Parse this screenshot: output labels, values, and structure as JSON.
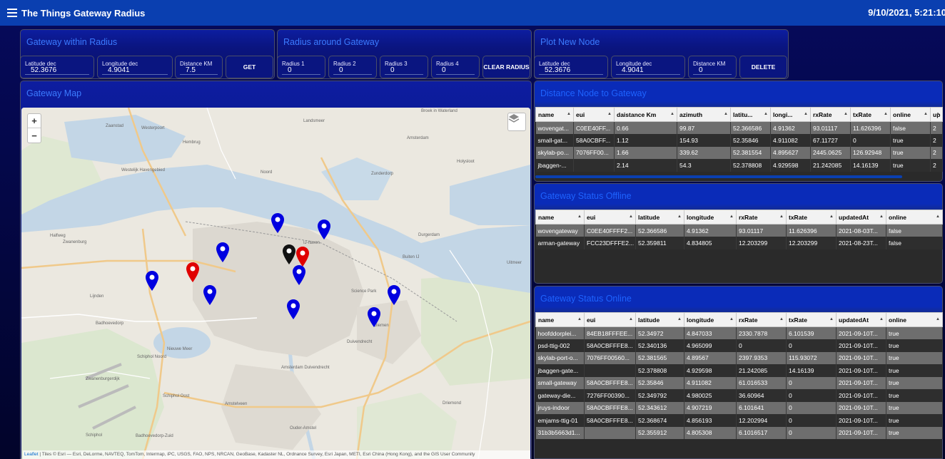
{
  "header": {
    "title": "The Things Gateway Radius",
    "datetime": "9/10/2021, 5:21:10"
  },
  "gateway_within_radius": {
    "title": "Gateway within Radius",
    "latitude": {
      "label": "Latitude dec",
      "value": "52.3676"
    },
    "longitude": {
      "label": "Longitude dec",
      "value": "4.9041"
    },
    "distance": {
      "label": "Distance KM",
      "value": "7.5"
    },
    "get_label": "GET"
  },
  "radius_around_gateway": {
    "title": "Radius around Gateway",
    "radius1": {
      "label": "Radius 1",
      "value": "0"
    },
    "radius2": {
      "label": "Radius 2",
      "value": "0"
    },
    "radius3": {
      "label": "Radius 3",
      "value": "0"
    },
    "radius4": {
      "label": "Radius 4",
      "value": "0"
    },
    "clear_label": "CLEAR RADIUS"
  },
  "plot_new_node": {
    "title": "Plot New Node",
    "latitude": {
      "label": "Latitude dec",
      "value": "52.3676"
    },
    "longitude": {
      "label": "Longitude dec",
      "value": "4.9041"
    },
    "distance": {
      "label": "Distance KM",
      "value": "0"
    },
    "delete_label": "DELETE"
  },
  "gateway_map": {
    "title": "Gateway Map",
    "zoom_in": "+",
    "zoom_out": "−",
    "attribution_link": "Leaflet",
    "attribution_text": " | Tiles © Esri — Esri, DeLorme, NAVTEQ, TomTom, Intermap, iPC, USGS, FAO, NPS, NRCAN, GeoBase, Kadaster NL, Ordnance Survey, Esri Japan, METI, Esri China (Hong Kong), and the GIS User Community",
    "labels": {
      "l1": "Zaanstad",
      "l2": "Westerpoort",
      "l3": "Hembrug",
      "l4": "Landsmeer",
      "l5": "Broek in Waterland",
      "l6": "Westelijk Havengebied",
      "l7": "Amsterdam",
      "l8": "Holysloot",
      "l9": "Zunderdorp",
      "l10": "Halfweg",
      "l11": "Noord",
      "l12": "Durgerdam",
      "l13": "Zwanenburg",
      "l14": "Buiten IJ",
      "l15": "Uitmeer",
      "l16": "Lijnden",
      "l17": "Badhoevedorp",
      "l18": "Science Park",
      "l19": "Diemen",
      "l20": "Duivendrecht",
      "l21": "Nieuwe Meer",
      "l22": "Schiphol Noord",
      "l23": "Amsterdam Duivendrecht",
      "l24": "Schiphol Oost",
      "l25": "Amstelveen",
      "l26": "Ouder-Amstel",
      "l27": "Driemond",
      "l28": "Schiphol",
      "l29": "Badhoevedorp-Zuid",
      "l30": "Zwanenburgerdijk",
      "l31": "IJ-haven"
    }
  },
  "distance_node_to_gateway": {
    "title": "Distance Node to Gateway",
    "columns": [
      "name",
      "eui",
      "daistance Km",
      "azimuth",
      "latitu...",
      "longi...",
      "rxRate",
      "txRate",
      "online",
      "up"
    ],
    "rows": [
      [
        "wovengat...",
        "C0EE40FF...",
        "0.66",
        "99.87",
        "52.366586",
        "4.91362",
        "93.01117",
        "11.626396",
        "false",
        "2"
      ],
      [
        "small-gat...",
        "58A0CBFF...",
        "1.12",
        "154.93",
        "52.35846",
        "4.911082",
        "67.11727",
        "0",
        "true",
        "2"
      ],
      [
        "skylab-po...",
        "7076FF00...",
        "1.66",
        "339.62",
        "52.381554",
        "4.895627",
        "2445.0625",
        "126.92948",
        "true",
        "2"
      ],
      [
        "jbaggen-...",
        "",
        "2.14",
        "54.3",
        "52.378808",
        "4.929598",
        "21.242085",
        "14.16139",
        "true",
        "2"
      ]
    ]
  },
  "gateway_status_offline": {
    "title": "Gateway Status Offline",
    "columns": [
      "name",
      "eui",
      "latitude",
      "longitude",
      "rxRate",
      "txRate",
      "updatedAt",
      "online"
    ],
    "rows": [
      [
        "wovengateway",
        "C0EE40FFFF2...",
        "52.366586",
        "4.91362",
        "93.01117",
        "11.626396",
        "2021-08-03T...",
        "false"
      ],
      [
        "arman-gateway",
        "FCC23DFFFE2...",
        "52.359811",
        "4.834805",
        "12.203299",
        "12.203299",
        "2021-08-23T...",
        "false"
      ]
    ]
  },
  "gateway_status_online": {
    "title": "Gateway Status Online",
    "columns": [
      "name",
      "eui",
      "latitude",
      "longitude",
      "rxRate",
      "txRate",
      "updatedAt",
      "online"
    ],
    "rows": [
      [
        "hoofddorplei...",
        "84EB18FFFEE...",
        "52.34972",
        "4.847033",
        "2330.7878",
        "6.101539",
        "2021-09-10T...",
        "true"
      ],
      [
        "psd-ttig-002",
        "58A0CBFFFE8...",
        "52.340136",
        "4.965099",
        "0",
        "0",
        "2021-09-10T...",
        "true"
      ],
      [
        "skylab-port-o...",
        "7076FF00560...",
        "52.381565",
        "4.89567",
        "2397.9353",
        "115.93072",
        "2021-09-10T...",
        "true"
      ],
      [
        "jbaggen-gate...",
        "",
        "52.378808",
        "4.929598",
        "21.242085",
        "14.16139",
        "2021-09-10T...",
        "true"
      ],
      [
        "small-gateway",
        "58A0CBFFFE8...",
        "52.35846",
        "4.911082",
        "61.016533",
        "0",
        "2021-09-10T...",
        "true"
      ],
      [
        "gateway-die...",
        "7276FF00390...",
        "52.349792",
        "4.980025",
        "36.60964",
        "0",
        "2021-09-10T...",
        "true"
      ],
      [
        "jruys-indoor",
        "58A0CBFFFE8...",
        "52.343612",
        "4.907219",
        "6.101641",
        "0",
        "2021-09-10T...",
        "true"
      ],
      [
        "emjams-ttig-01",
        "58A0CBFFFE8...",
        "52.368674",
        "4.856193",
        "12.202994",
        "0",
        "2021-09-10T...",
        "true"
      ],
      [
        "31b3b5663d1...",
        "",
        "52.355912",
        "4.805308",
        "6.1016517",
        "0",
        "2021-09-10T...",
        "true"
      ]
    ]
  },
  "colors": {
    "header": "#0a3fb0",
    "panel_title": "#3b7bff",
    "marker_blue": "#0000e0",
    "marker_red": "#e00000",
    "marker_black": "#111111"
  }
}
